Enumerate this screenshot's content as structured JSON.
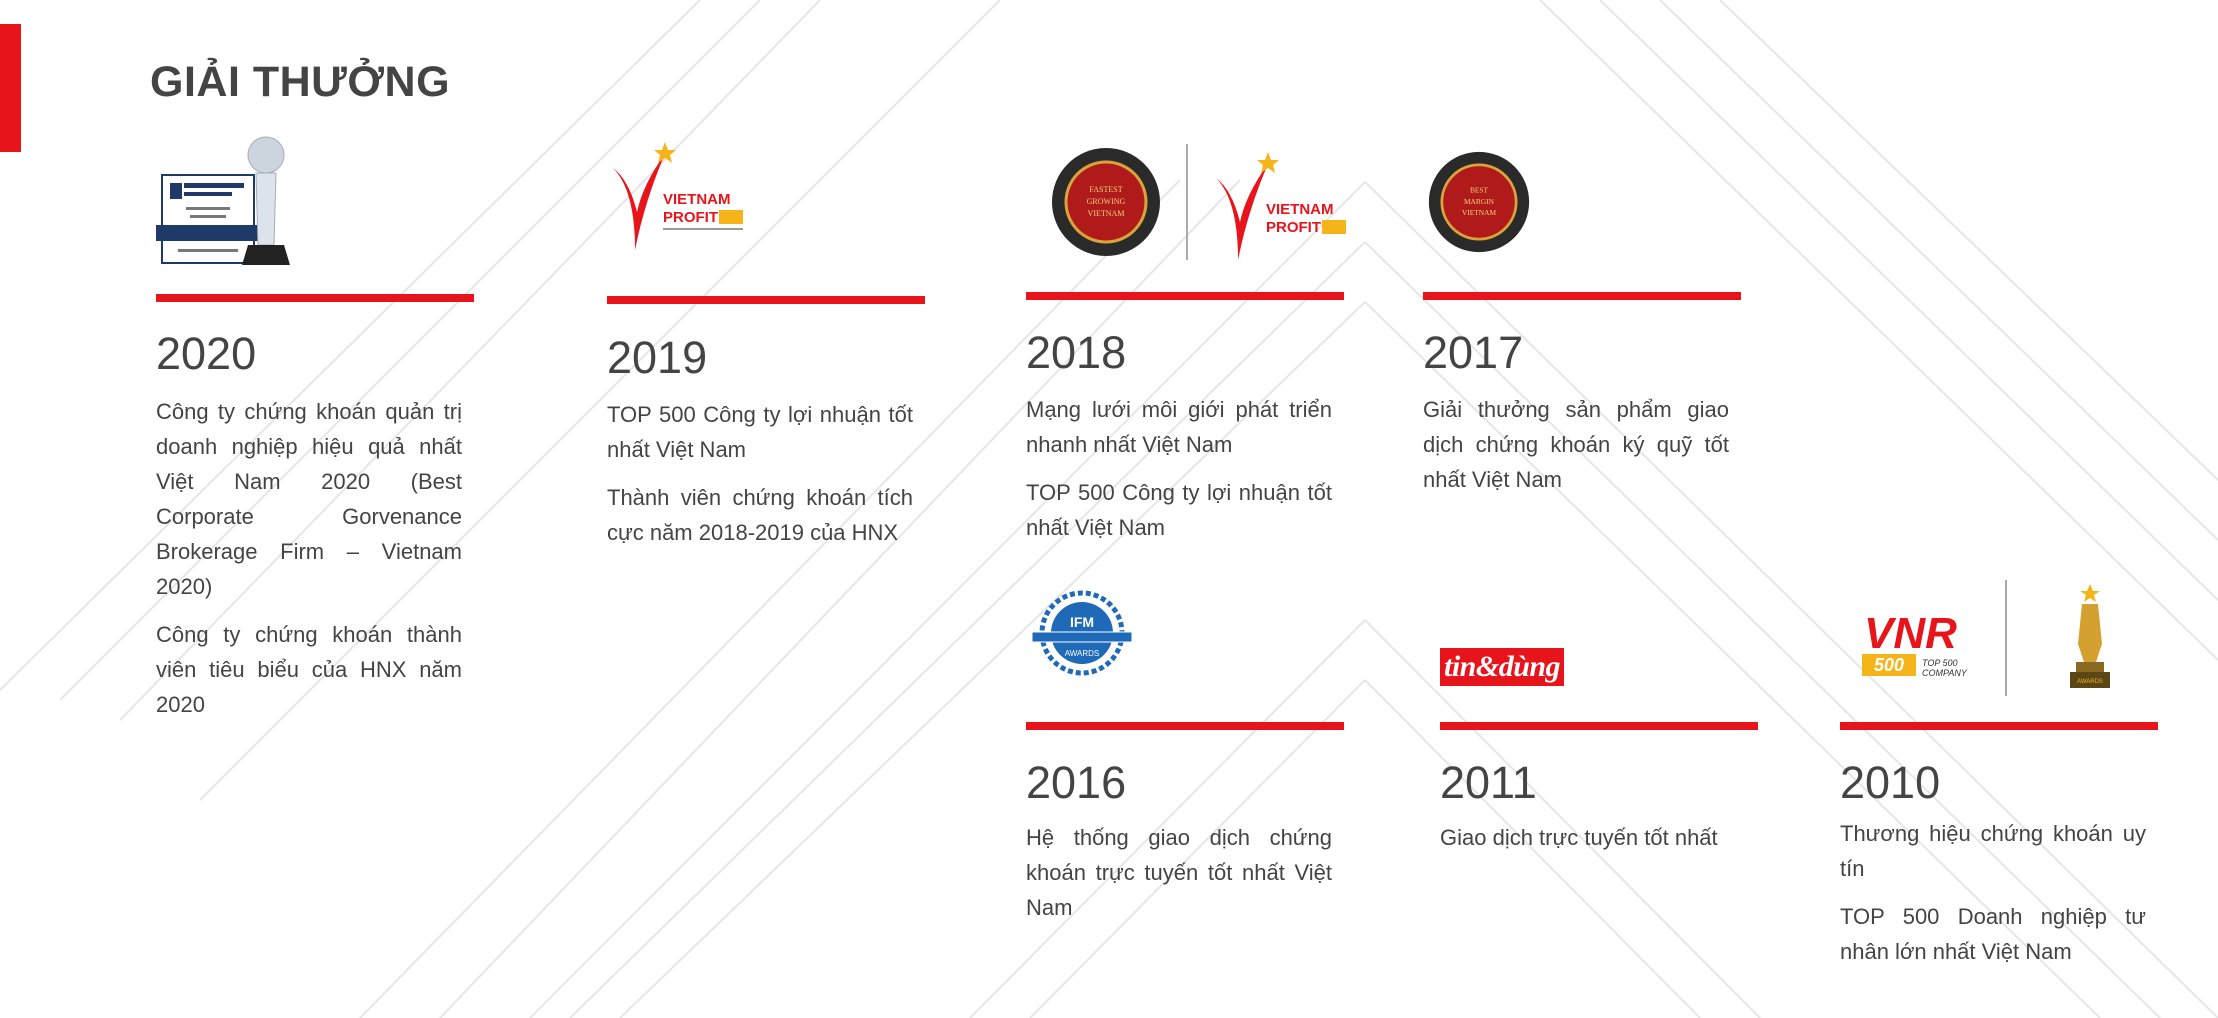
{
  "section": {
    "title": "GIẢI THƯỞNG"
  },
  "colors": {
    "accent": "#e8141b",
    "text": "#444444",
    "diagonal_lines": "#e6e6e6"
  },
  "awards": [
    {
      "year": "2020",
      "logos": [
        "finance-trophy-icon"
      ],
      "items": [
        "Công ty chứng khoán quản trị doanh nghiệp hiệu quả nhất Việt Nam 2020 (Best Corporate Gorvenance Brokerage Firm – Vietnam 2020)",
        "Công ty chứng khoán thành viên tiêu biểu của HNX năm 2020"
      ]
    },
    {
      "year": "2019",
      "logos": [
        "vietnam-profit-500-logo"
      ],
      "items": [
        "TOP 500 Công ty lợi nhuận tốt nhất Việt Nam",
        "Thành viên chứng khoán tích cực năm 2018-2019 của HNX"
      ]
    },
    {
      "year": "2018",
      "logos": [
        "gbaf-medal-logo",
        "vietnam-profit-500-logo"
      ],
      "items": [
        "Mạng lưới môi giới phát triển nhanh nhất Việt Nam",
        "TOP 500 Công ty lợi nhuận tốt nhất Việt Nam"
      ]
    },
    {
      "year": "2017",
      "logos": [
        "gbaf-medal-logo"
      ],
      "items": [
        "Giải thưởng sản phẩm giao dịch chứng khoán ký quỹ tốt nhất Việt Nam"
      ]
    },
    {
      "year": "2016",
      "logos": [
        "ifm-awards-logo"
      ],
      "items": [
        "Hệ thống giao dịch chứng khoán trực tuyến tốt nhất Việt Nam"
      ]
    },
    {
      "year": "2011",
      "logos": [
        "tin-dung-logo"
      ],
      "logo_text": "tin&dùng",
      "items": [
        "Giao dịch trực tuyến tốt nhất"
      ]
    },
    {
      "year": "2010",
      "logos": [
        "vnr500-logo",
        "gold-trophy-icon"
      ],
      "items": [
        "Thương hiệu chứng khoán uy tín",
        "TOP 500 Doanh nghiệp tư nhân lớn nhất Việt Nam"
      ]
    }
  ]
}
